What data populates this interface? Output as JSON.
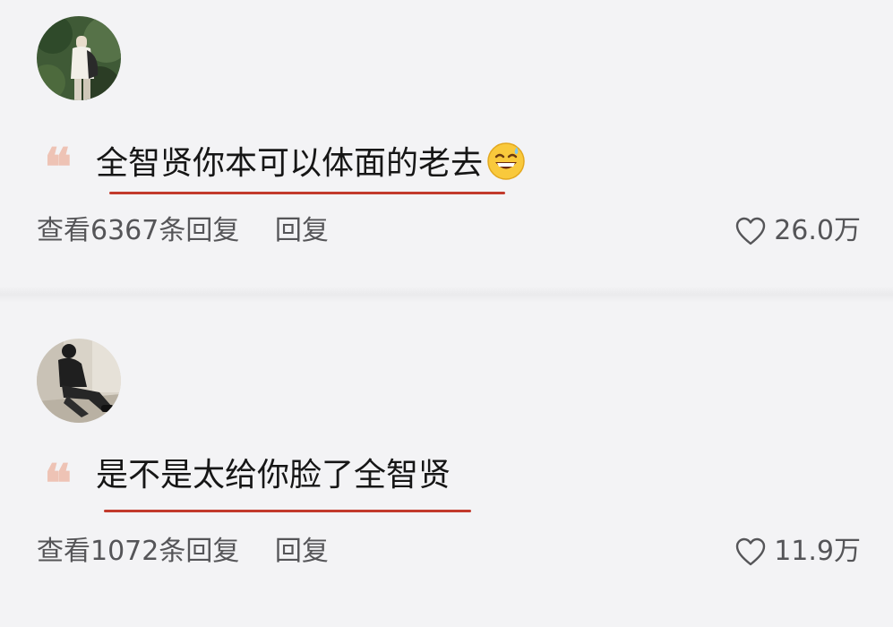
{
  "comments": [
    {
      "quote_mark": "❝",
      "text": "全智贤你本可以体面的老去",
      "emoji": "grinning-sweat-face",
      "view_replies_label": "查看6367条回复",
      "reply_label": "回复",
      "likes": "26.0万"
    },
    {
      "quote_mark": "❝",
      "text": "是不是太给你脸了全智贤",
      "view_replies_label": "查看1072条回复",
      "reply_label": "回复",
      "likes": "11.9万"
    }
  ],
  "colors": {
    "background": "#f3f3f5",
    "quote_mark": "#eec3b5",
    "underline": "#c23a2c",
    "meta_text": "#555558",
    "comment_text": "#161616"
  }
}
